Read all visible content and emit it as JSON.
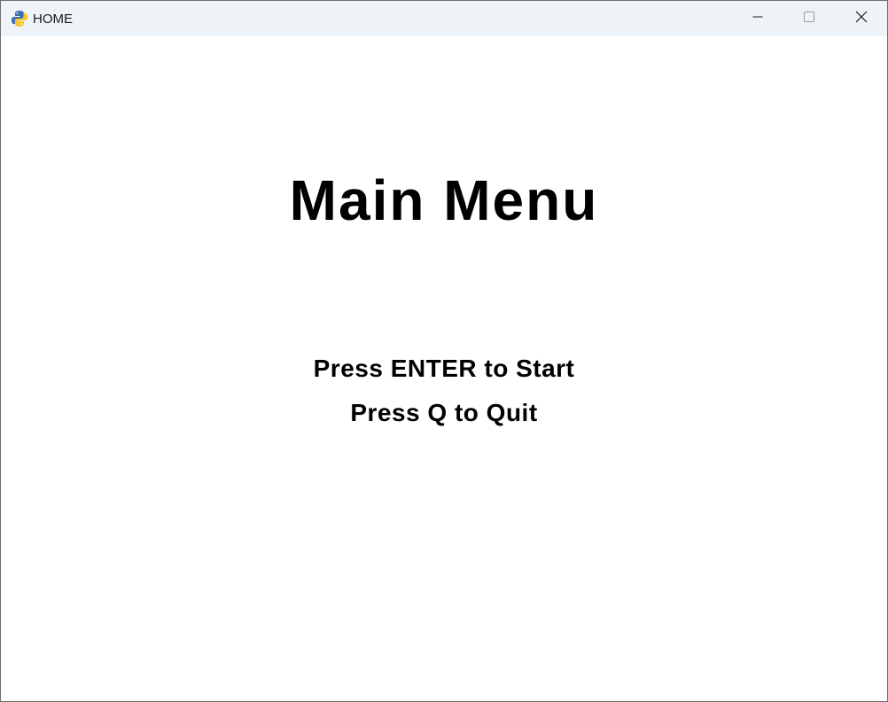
{
  "window": {
    "title": "HOME",
    "app_icon": "python-icon",
    "controls": {
      "minimize_icon": "minimize-icon",
      "maximize_icon": "maximize-icon",
      "close_icon": "close-icon"
    }
  },
  "menu": {
    "title": "Main Menu",
    "options": [
      {
        "label": "Press ENTER to Start"
      },
      {
        "label": "Press Q to Quit"
      }
    ]
  },
  "colors": {
    "background": "#ffffff",
    "text": "#000000",
    "titlebar": "#eef3f8"
  }
}
